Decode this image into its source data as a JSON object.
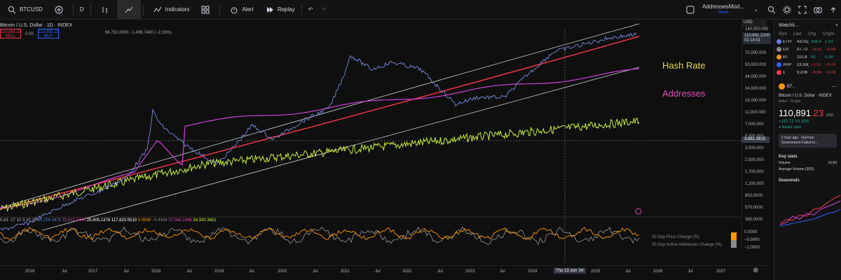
{
  "toolbar": {
    "symbol": "BTCUSD",
    "interval": "D",
    "indicators_label": "Indicators",
    "alert_label": "Alert",
    "replay_label": "Replay",
    "layout_name": "AddressesMod...",
    "layout_sub": "Save"
  },
  "chart_header": {
    "title": "Bitcoin / U.S. Dollar · 1D · INDEX",
    "sell_price": "110,891.23",
    "sell_label": "SELL",
    "spread": "0.00",
    "buy_price": "110,891.23",
    "buy_label": "BUY",
    "change": "66,751.0900 −1,496.7400 (−2.19%)"
  },
  "price_axis": {
    "currency": "USD",
    "last_price": "110,891.2300",
    "countdown": "02:14:01",
    "crosshair": "3,881.3815",
    "ticks": [
      "140,000.000",
      "100,000.000",
      "70,000.000",
      "50,000.000",
      "34,000.000",
      "24,000.000",
      "16,000.000",
      "11,000.000",
      "7,000,000",
      "5,000,000",
      "3,500,000",
      "2,500,000",
      "1,700,000",
      "1,200,000",
      "850,0000",
      "570,0000",
      "390,0000"
    ]
  },
  "annotations": {
    "hash_rate": "Hash Rate",
    "addresses": "Addresses"
  },
  "oscillator": {
    "values": [
      {
        "text": "5.83 ·27 10 3 20 20",
        "color": "#b2b5be"
      },
      {
        "text": "69,259.3470",
        "color": "#5b7bd5"
      },
      {
        "text": "73,512.8444",
        "color": "#e04fb8"
      },
      {
        "text": "29,405.1378",
        "color": "#ffffff"
      },
      {
        "text": "117,620.5510",
        "color": "#ffffff"
      },
      {
        "text": "0.0948",
        "color": "#ff9800"
      },
      {
        "text": "−0.4344",
        "color": "#8a8a8a"
      },
      {
        "text": "37,042.1346",
        "color": "#e04fb8"
      },
      {
        "text": "34,930.3651",
        "color": "#c6f03a"
      }
    ],
    "legend_price": "30 Day Price Change (%)",
    "legend_addr": "30 Day Active Addresses Change (%)",
    "ticks": [
      "0.0000",
      "−0.5000",
      "−1.0000"
    ],
    "price_color": "#ff9800",
    "addr_color": "#8a8a8a"
  },
  "time_axis": {
    "ticks": [
      "2016",
      "Jul",
      "2017",
      "Jul",
      "2018",
      "Jul",
      "2019",
      "Jul",
      "2020",
      "Jul",
      "2021",
      "Jul",
      "2022",
      "Jul",
      "2023",
      "Jul",
      "2024",
      "Thu 13 Jun '24",
      "2025",
      "Jul",
      "2026",
      "Jul",
      "2027"
    ]
  },
  "colors": {
    "price_line": "#7b8ae0",
    "hash_rate": "#c6f03a",
    "addresses": "#d23fe0",
    "regression": "#f23645",
    "channel": "#d1d4dc"
  },
  "watchlist": {
    "title": "Watchli...",
    "columns": [
      "Sym",
      "Last",
      "Chg",
      "Chg%"
    ],
    "rows": [
      {
        "sym": "ETH",
        "last": "43,01(",
        "chg": "438.4",
        "chgp": "1.03",
        "color": "#22ab94",
        "dot": "#627eea"
      },
      {
        "sym": "DX",
        "last": "97.73",
        "chg": "−0.52",
        "chgp": "−0.54",
        "color": "#f23645",
        "dot": "#888888"
      },
      {
        "sym": "BT",
        "last": "110,8",
        "chg": "92",
        "chgp": "0.08",
        "color": "#22ab94",
        "dot": "#f7931a"
      },
      {
        "sym": "XRP",
        "last": "23,59(",
        "chg": "−173.",
        "chgp": "−0.73",
        "color": "#f23645",
        "dot": "#2962ff"
      },
      {
        "sym": "1",
        "last": "9,208",
        "chg": "−6.66",
        "chgp": "−0.09",
        "color": "#f23645",
        "dot": "#f23645"
      }
    ]
  },
  "detail": {
    "symbol": "BT...",
    "name": "Bitcoin / U.S. Dollar",
    "exchange": "INDEX",
    "type": "Index · Crypto",
    "price_main": "110,891",
    "price_red": ".23",
    "currency": "USD",
    "change": "+110.71 +0.10%",
    "market": "● Market open",
    "news": "1 hour ago · German Government Failed to...",
    "key_stats_title": "Key stats",
    "volume_label": "Volume",
    "volume_value": "10.83",
    "avg_volume_label": "Average Volume (30D)",
    "seasonals_title": "Seasonals"
  }
}
